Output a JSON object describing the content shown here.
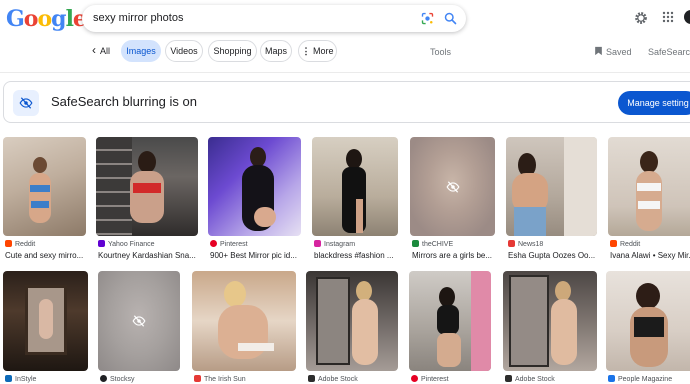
{
  "brand": {
    "logo_text": [
      "G",
      "o",
      "o",
      "g",
      "l",
      "e"
    ],
    "logo_colors": [
      "#4285f4",
      "#ea4335",
      "#fbbc05",
      "#4285f4",
      "#34a853",
      "#ea4335"
    ]
  },
  "search": {
    "query": "sexy mirror photos"
  },
  "tabs": {
    "back": "‹",
    "all": "All",
    "images": "Images",
    "videos": "Videos",
    "shopping": "Shopping",
    "maps": "Maps",
    "more": "More",
    "tools": "Tools",
    "saved": "Saved",
    "safesearch": "SafeSearch"
  },
  "safesearch_banner": {
    "title": "SafeSearch blurring is on",
    "button": "Manage setting"
  },
  "row1": [
    {
      "source": "Reddit",
      "caption": "Cute and sexy mirro...",
      "icon_color": "#ff4500",
      "blurred": false
    },
    {
      "source": "Yahoo Finance",
      "caption": "Kourtney Kardashian Sna...",
      "icon_color": "#6001d2",
      "blurred": false
    },
    {
      "source": "Pinterest",
      "caption": "900+ Best Mirror pic id...",
      "icon_color": "#e60023",
      "blurred": false
    },
    {
      "source": "Instagram",
      "caption": "blackdress #fashion ...",
      "icon_color": "#d6249f",
      "blurred": false
    },
    {
      "source": "theCHIVE",
      "caption": "Mirrors are a girls be...",
      "icon_color": "#1b8a3d",
      "blurred": true
    },
    {
      "source": "News18",
      "caption": "Esha Gupta Oozes Oo...",
      "icon_color": "#e53935",
      "blurred": false
    },
    {
      "source": "Reddit",
      "caption": "Ivana Alawi • Sexy Mir...",
      "icon_color": "#ff4500",
      "blurred": false
    }
  ],
  "row2": [
    {
      "source": "InStyle",
      "icon_color": "#0d6ab8",
      "blurred": false
    },
    {
      "source": "Stocksy",
      "icon_color": "#202124",
      "blurred": true
    },
    {
      "source": "The Irish Sun",
      "icon_color": "#e53935",
      "blurred": false
    },
    {
      "source": "Adobe Stock",
      "icon_color": "#2d2d2d",
      "blurred": false
    },
    {
      "source": "Pinterest",
      "icon_color": "#e60023",
      "blurred": false
    },
    {
      "source": "Adobe Stock",
      "icon_color": "#2d2d2d",
      "blurred": false
    },
    {
      "source": "People Magazine",
      "icon_color": "#1a73e8",
      "blurred": false
    }
  ]
}
